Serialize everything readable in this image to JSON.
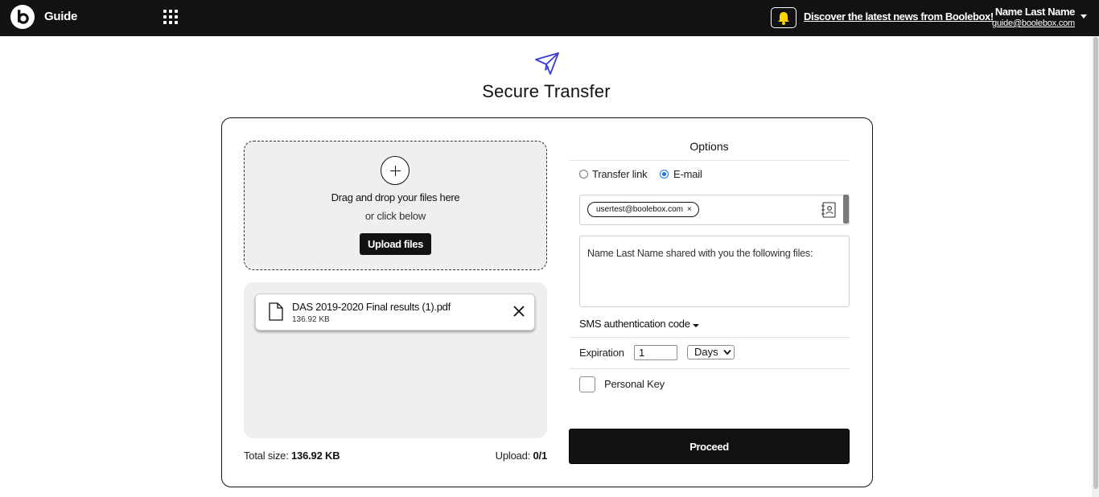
{
  "header": {
    "app_title": "Guide",
    "news_link": "Discover the latest news from Boolebox!",
    "user_name": "Name Last Name",
    "user_email": "guide@boolebox.com"
  },
  "page": {
    "title": "Secure Transfer"
  },
  "upload": {
    "drop_text": "Drag and drop your files here",
    "or_text": "or click below",
    "button_label": "Upload files"
  },
  "files": [
    {
      "name": "DAS 2019-2020 Final results (1).pdf",
      "size": "136.92 KB"
    }
  ],
  "summary": {
    "total_size_label": "Total size:",
    "total_size_value": "136.92 KB",
    "upload_label": "Upload:",
    "upload_value": "0/1"
  },
  "options": {
    "title": "Options",
    "radio_transfer_link": "Transfer link",
    "radio_email": "E-mail",
    "selected_mode": "E-mail",
    "recipients": [
      "usertest@boolebox.com"
    ],
    "chip_remove": "×",
    "message": "Name Last Name shared with you the following files:",
    "sms_label": "SMS authentication code",
    "expiration_label": "Expiration",
    "expiration_value": "1",
    "expiration_unit": "Days",
    "personal_key_label": "Personal Key",
    "personal_key_checked": false,
    "proceed_label": "Proceed"
  },
  "colors": {
    "topbar": "#121212",
    "accent_radio": "#1a73e8",
    "plane_icon": "#3b3bd6",
    "bell": "#ffd400"
  }
}
